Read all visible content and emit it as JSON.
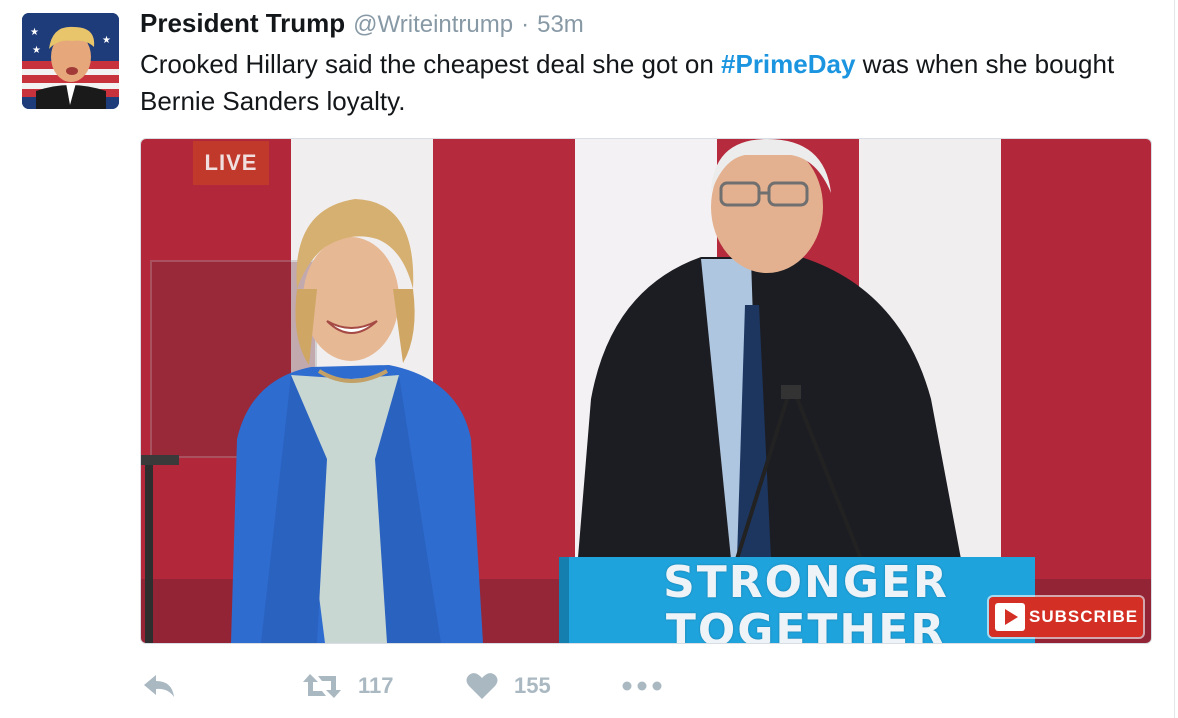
{
  "tweet": {
    "display_name": "President Trump",
    "handle": "@Writeintrump",
    "separator": "·",
    "time": "53m",
    "text_before": "Crooked Hillary said the cheapest deal she got on ",
    "hashtag": "#PrimeDay",
    "text_after": " was when she bought Bernie Sanders loyalty."
  },
  "media": {
    "live_label": "LIVE",
    "podium_line_1": "STRONGER",
    "podium_line_2": "TOGETHER",
    "subscribe_label": "SUBSCRIBE"
  },
  "actions": {
    "retweet_count": "117",
    "like_count": "155"
  },
  "colors": {
    "hashtag": "#1b95e0",
    "meta_text": "#8899a6",
    "action_icon": "#aab8c2",
    "subscribe_red": "#d42f24",
    "podium_blue": "#1fa3dc",
    "stripe_red": "#b52a3c"
  },
  "icons": {
    "reply": "reply-arrow-icon",
    "retweet": "retweet-icon",
    "like": "heart-icon",
    "more": "ellipsis-icon"
  }
}
